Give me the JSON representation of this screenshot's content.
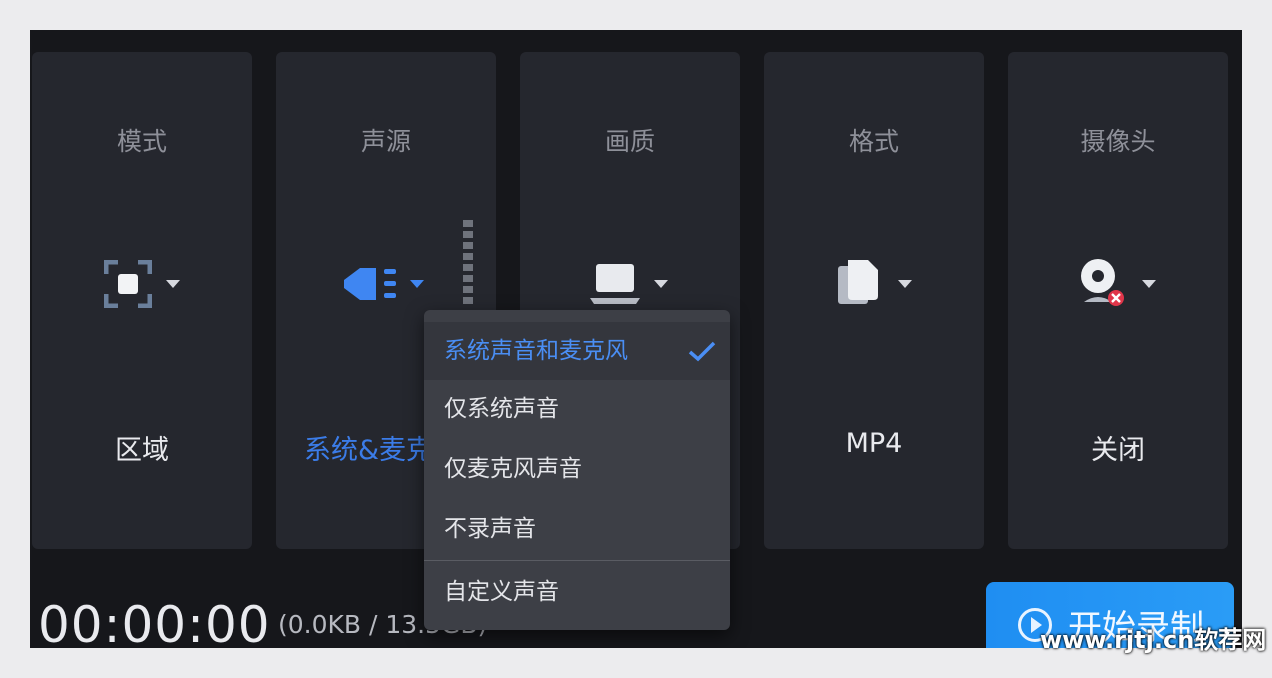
{
  "panels": {
    "mode": {
      "title": "模式",
      "value": "区域",
      "icon": "region-select-icon"
    },
    "audio": {
      "title": "声源",
      "value": "系统&麦克",
      "icon": "speaker-icon"
    },
    "quality": {
      "title": "画质",
      "icon": "laptop-icon"
    },
    "format": {
      "title": "格式",
      "value": "MP4",
      "icon": "file-icon"
    },
    "camera": {
      "title": "摄像头",
      "value": "关闭",
      "icon": "webcam-off-icon"
    }
  },
  "audio_dropdown": {
    "options": [
      {
        "label": "系统声音和麦克风",
        "selected": true
      },
      {
        "label": "仅系统声音",
        "selected": false
      },
      {
        "label": "仅麦克风声音",
        "selected": false
      },
      {
        "label": "不录声音",
        "selected": false
      },
      {
        "label": "自定义声音",
        "selected": false
      }
    ]
  },
  "status": {
    "timer": "00:00:00",
    "size": "(0.0KB / 13.5GB)"
  },
  "start_button": {
    "label": "开始录制"
  },
  "watermark": "www.rjtj.cn软荐网",
  "colors": {
    "accent": "#3b7ce8",
    "panel_bg": "#25272e",
    "app_bg": "#16171b",
    "button_bg": "#1f8ef2",
    "close_badge": "#e0364a"
  }
}
